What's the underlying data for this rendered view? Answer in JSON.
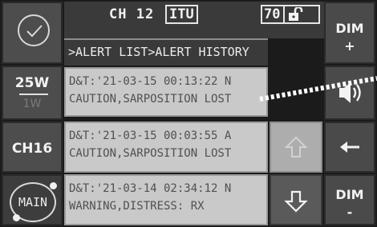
{
  "header": {
    "channel_label": "CH 12",
    "channel_mode": "ITU",
    "volume_level": "70"
  },
  "breadcrumb": ">ALERT LIST>ALERT HISTORY",
  "left_buttons": {
    "power_high": "25W",
    "power_low": "1W",
    "ch16_label": "CH16",
    "main_label": "MAIN"
  },
  "alerts": [
    {
      "line1": "D&T:'21-03-15 00:13:22 N",
      "line2": "CAUTION,SARPOSITION LOST"
    },
    {
      "line1": "D&T:'21-03-15 00:03:55 A",
      "line2": "CAUTION,SARPOSITION LOST"
    },
    {
      "line1": "D&T:'21-03-14 02:34:12 N",
      "line2": "WARNING,DISTRESS: RX"
    }
  ],
  "right_buttons": {
    "dim_up_label": "DIM",
    "dim_up_sign": "+",
    "dim_down_label": "DIM",
    "dim_down_sign": "-"
  },
  "icons": {
    "ok": "check-icon",
    "lock": "unlock-icon",
    "speaker": "speaker-icon",
    "back": "back-arrow-icon",
    "up": "arrow-up-icon",
    "down": "arrow-down-icon"
  }
}
